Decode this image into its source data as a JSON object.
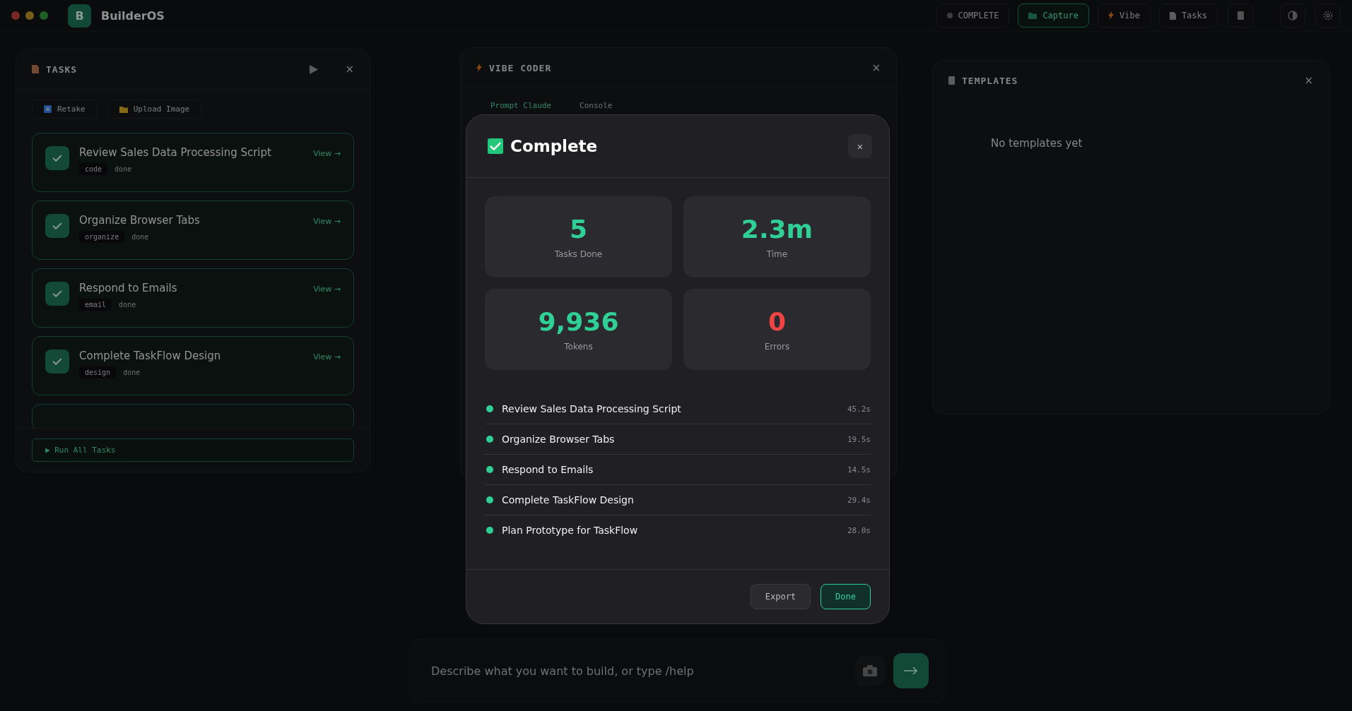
{
  "app": {
    "logo_letter": "B",
    "title": "BuilderOS"
  },
  "toolbar": [
    {
      "label": "COMPLETE",
      "kind": "status",
      "selected": false
    },
    {
      "label": "Capture",
      "kind": "capture",
      "selected": true
    },
    {
      "label": "Vibe",
      "kind": "vibe",
      "selected": false
    },
    {
      "label": "Tasks",
      "kind": "tasks",
      "selected": false
    }
  ],
  "tasks_panel": {
    "title": "TASKS",
    "close": "×",
    "actions": [
      {
        "label": "Retake",
        "kind": "retake"
      },
      {
        "label": "Upload Image",
        "kind": "upload"
      }
    ],
    "tasks": [
      {
        "title": "Review Sales Data Processing Script",
        "tag": "code",
        "status": "done",
        "link": "View →",
        "done": true
      },
      {
        "title": "Organize Browser Tabs",
        "tag": "organize",
        "status": "done",
        "link": "View →",
        "done": true
      },
      {
        "title": "Respond to Emails",
        "tag": "email",
        "status": "done",
        "link": "View →",
        "done": true
      },
      {
        "title": "Complete TaskFlow Design",
        "tag": "design",
        "status": "done",
        "link": "View →",
        "done": true
      }
    ],
    "run_button": "▶ Run All Tasks"
  },
  "vibe_panel": {
    "title": "VIBE CODER",
    "close": "×",
    "tabs": [
      {
        "label": "Prompt Claude",
        "selected": true
      },
      {
        "label": "Console",
        "selected": false
      }
    ]
  },
  "templates_panel": {
    "title": "TEMPLATES",
    "close": "×",
    "empty_text": "No templates yet"
  },
  "prompt": {
    "placeholder": "Describe what you want to build, or type /help"
  },
  "modal": {
    "title": "Complete",
    "close": "×",
    "stats": [
      {
        "value": "5",
        "label": "Tasks Done",
        "color": "#2fcf95"
      },
      {
        "value": "2.3m",
        "label": "Time",
        "color": "#2fcf95"
      },
      {
        "value": "9,936",
        "label": "Tokens",
        "color": "#2fcf95"
      },
      {
        "value": "0",
        "label": "Errors",
        "color": "#ef4444"
      }
    ],
    "results": [
      {
        "name": "Review Sales Data Processing Script",
        "time": "45.2s"
      },
      {
        "name": "Organize Browser Tabs",
        "time": "19.5s"
      },
      {
        "name": "Respond to Emails",
        "time": "14.5s"
      },
      {
        "name": "Complete TaskFlow Design",
        "time": "29.4s"
      },
      {
        "name": "Plan Prototype for TaskFlow",
        "time": "28.0s"
      }
    ],
    "buttons": [
      {
        "label": "Export",
        "kind": "secondary"
      },
      {
        "label": "Done",
        "kind": "primary"
      }
    ]
  }
}
